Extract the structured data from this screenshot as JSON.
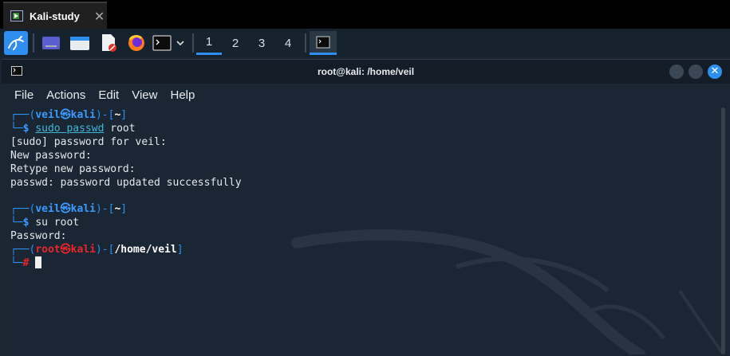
{
  "vm_tab": {
    "title": "Kali-study",
    "close": "✕"
  },
  "panel": {
    "workspaces": [
      "1",
      "2",
      "3",
      "4"
    ],
    "active_workspace": "1"
  },
  "window": {
    "title": "root@kali: /home/veil",
    "close_glyph": "✕"
  },
  "menu": [
    "File",
    "Actions",
    "Edit",
    "View",
    "Help"
  ],
  "terminal": {
    "l1": {
      "pre": "┌──(",
      "user": "veil",
      "at": "㉿",
      "host": "kali",
      "mid": ")-[",
      "dir": "~",
      "end": "]"
    },
    "l2": {
      "pre": "└─",
      "prompt": "$ ",
      "cmd_a": "sudo",
      "cmd_b": " passwd",
      "cmd_c": " root"
    },
    "out1": "[sudo] password for veil:",
    "out2": "New password:",
    "out3": "Retype new password:",
    "out4": "passwd: password updated successfully",
    "l5": {
      "pre": "┌──(",
      "user": "veil",
      "at": "㉿",
      "host": "kali",
      "mid": ")-[",
      "dir": "~",
      "end": "]"
    },
    "l6": {
      "pre": "└─",
      "prompt": "$ ",
      "cmd": "su root"
    },
    "out5": "Password:",
    "l8": {
      "pre": "┌──(",
      "user": "root",
      "at": "㉿",
      "host": "kali",
      "mid": ")-[",
      "dir": "/home/veil",
      "end": "]"
    },
    "l9": {
      "pre": "└─",
      "prompt": "# "
    }
  },
  "colors": {
    "accent": "#2f8ff0",
    "root": "#e8262b",
    "bg": "#1a2633"
  }
}
